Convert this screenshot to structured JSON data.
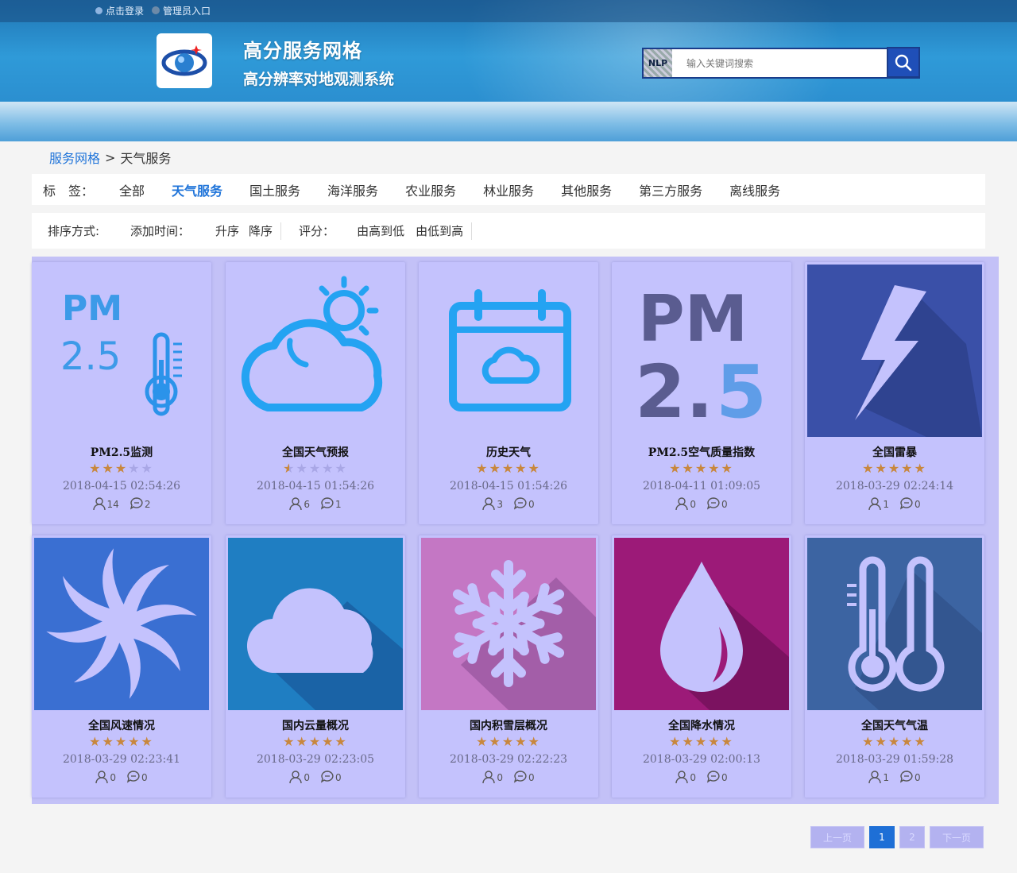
{
  "topbar": {
    "login_label": "点击登录",
    "admin_label": "管理员入口"
  },
  "site": {
    "title": "高分服务网格",
    "subtitle": "高分辨率对地观测系统"
  },
  "search": {
    "badge": "NLP",
    "placeholder": "输入关键词搜索"
  },
  "breadcrumb": {
    "root": "服务网格",
    "separator": ">",
    "current": "天气服务"
  },
  "tags": {
    "label": "标　签：",
    "items": [
      "全部",
      "天气服务",
      "国土服务",
      "海洋服务",
      "农业服务",
      "林业服务",
      "其他服务",
      "第三方服务",
      "离线服务"
    ],
    "active_index": 1
  },
  "sort": {
    "label": "排序方式:",
    "time_label": "添加时间：",
    "asc": "升序",
    "desc": "降序",
    "rating_label": "评分：",
    "high_to_low": "由高到低",
    "low_to_high": "由低到高"
  },
  "cards": [
    {
      "name": "PM2.5监测",
      "rating": 3,
      "date": "2018-04-15 02:54:26",
      "users": "14",
      "comments": "2",
      "icon": "pm25-thermometer-icon"
    },
    {
      "name": "全国天气预报",
      "rating": 0.5,
      "date": "2018-04-15 01:54:26",
      "users": "6",
      "comments": "1",
      "icon": "cloud-sun-icon"
    },
    {
      "name": "历史天气",
      "rating": 5,
      "date": "2018-04-15 01:54:26",
      "users": "3",
      "comments": "0",
      "icon": "calendar-cloud-icon"
    },
    {
      "name": "PM2.5空气质量指数",
      "rating": 5,
      "date": "2018-04-11 01:09:05",
      "users": "0",
      "comments": "0",
      "icon": "pm25-icon"
    },
    {
      "name": "全国雷暴",
      "rating": 5,
      "date": "2018-03-29 02:24:14",
      "users": "1",
      "comments": "0",
      "icon": "lightning-icon"
    },
    {
      "name": "全国风速情况",
      "rating": 5,
      "date": "2018-03-29 02:23:41",
      "users": "0",
      "comments": "0",
      "icon": "wind-spiral-icon"
    },
    {
      "name": "国内云量概况",
      "rating": 5,
      "date": "2018-03-29 02:23:05",
      "users": "0",
      "comments": "0",
      "icon": "cloud-icon"
    },
    {
      "name": "国内积雪层概况",
      "rating": 5,
      "date": "2018-03-29 02:22:23",
      "users": "0",
      "comments": "0",
      "icon": "snowflake-icon"
    },
    {
      "name": "全国降水情况",
      "rating": 5,
      "date": "2018-03-29 02:00:13",
      "users": "0",
      "comments": "0",
      "icon": "raindrop-icon"
    },
    {
      "name": "全国天气气温",
      "rating": 5,
      "date": "2018-03-29 01:59:28",
      "users": "1",
      "comments": "0",
      "icon": "thermometers-icon"
    }
  ],
  "pager": {
    "prev": "上一页",
    "pages": [
      "1",
      "2"
    ],
    "current": "1",
    "next": "下一页"
  },
  "colors": {
    "accent": "#1e73d9",
    "star": "#c8873d",
    "overlay": "#c4c2fd"
  }
}
